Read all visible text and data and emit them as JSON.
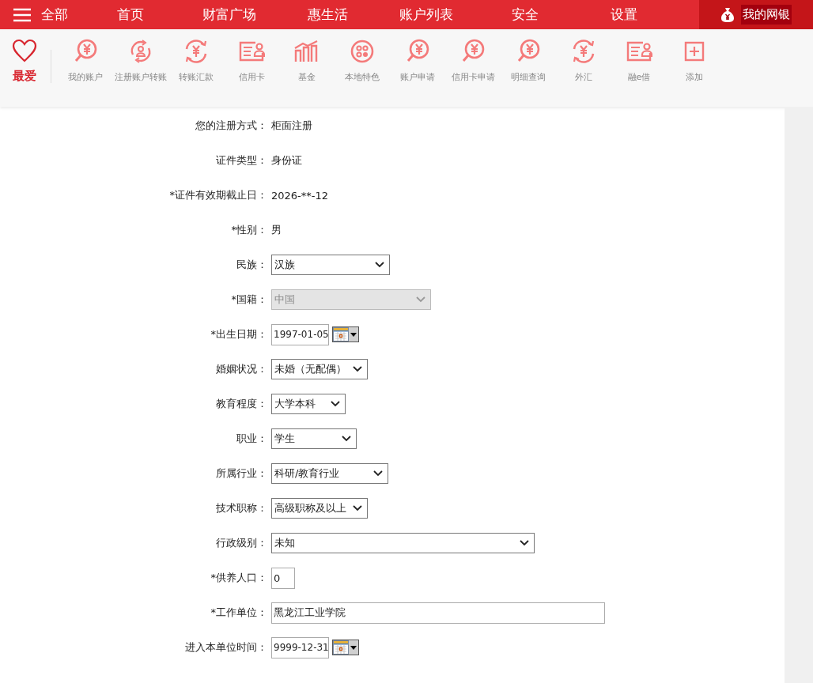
{
  "nav": {
    "menu_label": "全部",
    "items": [
      {
        "label": "首页",
        "selected": false
      },
      {
        "label": "财富广场",
        "selected": false
      },
      {
        "label": "惠生活",
        "selected": false
      },
      {
        "label": "账户列表",
        "selected": false
      },
      {
        "label": "安全",
        "selected": false
      },
      {
        "label": "设置",
        "selected": false
      }
    ],
    "my_bank": {
      "label": "我的网银",
      "selected": true
    }
  },
  "toolbar": {
    "favorite": "最爱",
    "items": [
      {
        "kind": "yen-bubble",
        "label": "我的账户"
      },
      {
        "kind": "user-cycle",
        "label": "注册账户转账"
      },
      {
        "kind": "yen-cycle",
        "label": "转账汇款"
      },
      {
        "kind": "card",
        "label": "信用卡"
      },
      {
        "kind": "chart",
        "label": "基金"
      },
      {
        "kind": "dots",
        "label": "本地特色"
      },
      {
        "kind": "yen-bubble",
        "label": "账户申请"
      },
      {
        "kind": "yen-bubble",
        "label": "信用卡申请"
      },
      {
        "kind": "yen-bubble",
        "label": "明细查询"
      },
      {
        "kind": "yen-cycle",
        "label": "外汇"
      },
      {
        "kind": "card",
        "label": "融e借"
      },
      {
        "kind": "plus",
        "label": "添加"
      }
    ]
  },
  "form": {
    "rows": [
      {
        "kind": "text",
        "label": "您的注册方式：",
        "value": "柜面注册"
      },
      {
        "kind": "text",
        "label": "证件类型：",
        "value": "身份证"
      },
      {
        "kind": "text",
        "label": "*证件有效期截止日：",
        "value": "2026-**-12"
      },
      {
        "kind": "text",
        "label": "*性别：",
        "value": "男"
      },
      {
        "kind": "select",
        "label": "民族：",
        "value": "汉族",
        "disabled": false
      },
      {
        "kind": "select",
        "label": "*国籍：",
        "value": "中国",
        "disabled": true
      },
      {
        "kind": "date",
        "label": "*出生日期：",
        "value": "1997-01-05"
      },
      {
        "kind": "select",
        "label": "婚姻状况：",
        "value": "未婚（无配偶）",
        "disabled": false
      },
      {
        "kind": "select",
        "label": "教育程度：",
        "value": "大学本科",
        "disabled": false
      },
      {
        "kind": "select",
        "label": "职业：",
        "value": "学生",
        "disabled": false
      },
      {
        "kind": "select",
        "label": "所属行业：",
        "value": "科研/教育行业",
        "disabled": false
      },
      {
        "kind": "select",
        "label": "技术职称：",
        "value": "高级职称及以上",
        "disabled": false
      },
      {
        "kind": "select",
        "label": "行政级别：",
        "value": "未知",
        "disabled": false
      },
      {
        "kind": "input",
        "label": "*供养人口：",
        "value": "0"
      },
      {
        "kind": "input",
        "label": "*工作单位：",
        "value": "黑龙江工业学院"
      },
      {
        "kind": "date",
        "label": "进入本单位时间：",
        "value": "9999-12-31"
      }
    ]
  }
}
